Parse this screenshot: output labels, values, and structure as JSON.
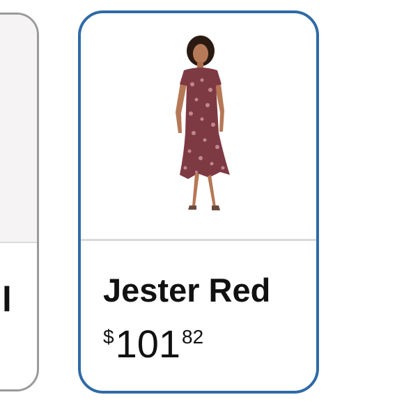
{
  "left_card": {
    "partial_title": "l"
  },
  "product_card": {
    "image_subject": "product-photo-dress",
    "title": "Jester Red",
    "price": {
      "currency": "$",
      "whole": "101",
      "fraction": "82"
    },
    "border_color": "#2f6aa6",
    "selected": true
  }
}
